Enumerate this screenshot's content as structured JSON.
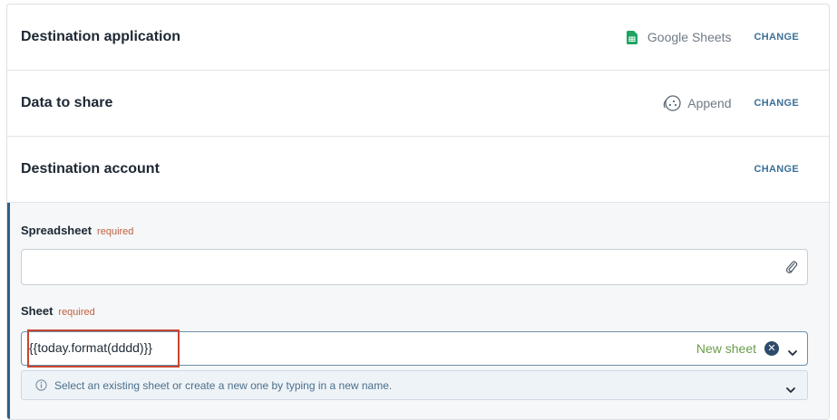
{
  "sections": {
    "destination_application": {
      "title": "Destination application",
      "app_name": "Google Sheets",
      "change": "CHANGE",
      "app_icon": "google-sheets-icon"
    },
    "data_to_share": {
      "title": "Data to share",
      "mode": "Append",
      "change": "CHANGE",
      "mode_icon": "append-icon"
    },
    "destination_account": {
      "title": "Destination account",
      "change": "CHANGE"
    }
  },
  "form": {
    "spreadsheet": {
      "label": "Spreadsheet",
      "required": "required",
      "value": "",
      "icon": "paperclip-icon"
    },
    "sheet": {
      "label": "Sheet",
      "required": "required",
      "value": "{{today.format(dddd)}}",
      "new_sheet": "New sheet",
      "hint": "Select an existing sheet or create a new one by typing in a new name."
    }
  },
  "colors": {
    "accent_blue": "#2d5f8c",
    "change_link": "#3b7097",
    "required": "#c2603f",
    "new_sheet": "#6a9e4b",
    "highlight_box": "#c8452e",
    "sheets_green": "#1fa463"
  }
}
